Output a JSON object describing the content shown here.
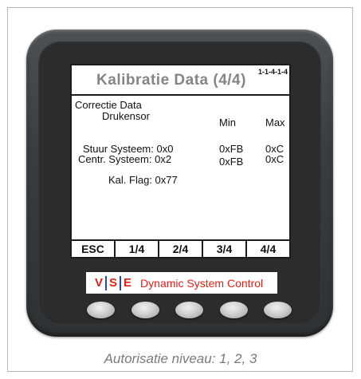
{
  "screen": {
    "title": "Kalibratie Data (4/4)",
    "code": "1-1-4-1-4",
    "section": "Correctie Data",
    "subsection": "Drukensor",
    "col_min": "Min",
    "col_max": "Max",
    "rows": [
      {
        "label": "Stuur Systeem: 0x0",
        "min": "0xFB",
        "max": "0xC"
      },
      {
        "label": "Centr. Systeem: 0x2",
        "min": "0xFB",
        "max": "0xC"
      }
    ],
    "flag": "Kal. Flag: 0x77"
  },
  "softkeys": [
    "ESC",
    "1/4",
    "2/4",
    "3/4",
    "4/4"
  ],
  "brand": {
    "letters": [
      "V",
      "S",
      "E"
    ],
    "name": "Dynamic System Control",
    "color": "#e0211a"
  },
  "caption": "Autorisatie niveau: 1, 2, 3"
}
